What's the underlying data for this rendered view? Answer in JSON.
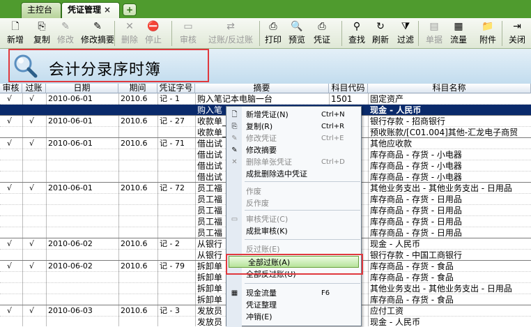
{
  "tabs": [
    {
      "label": "主控台"
    },
    {
      "label": "凭证管理",
      "close": "×"
    }
  ],
  "add_tab": "+",
  "toolbar": [
    {
      "label": "新增",
      "icon": "new-doc-icon",
      "glyph": "🗋",
      "disabled": false
    },
    {
      "label": "复制",
      "icon": "copy-icon",
      "glyph": "⎘",
      "disabled": false
    },
    {
      "label": "修改",
      "icon": "edit-icon",
      "glyph": "✎",
      "disabled": true
    },
    {
      "label": "修改摘要",
      "icon": "edit-summary-icon",
      "glyph": "✎",
      "disabled": false
    },
    {
      "label": "删除",
      "icon": "delete-icon",
      "glyph": "✕",
      "disabled": true
    },
    {
      "label": "停止",
      "icon": "stop-icon",
      "glyph": "⛔",
      "disabled": true
    },
    {
      "label": "审核",
      "icon": "audit-icon",
      "glyph": "▭",
      "disabled": true
    },
    {
      "label": "过账/反过账",
      "icon": "post-icon",
      "glyph": "⇄",
      "disabled": true
    },
    {
      "label": "打印",
      "icon": "print-icon",
      "glyph": "⎙",
      "disabled": false
    },
    {
      "label": "预览",
      "icon": "preview-icon",
      "glyph": "🔍",
      "disabled": false
    },
    {
      "label": "凭证",
      "icon": "voucher-icon",
      "glyph": "⎙",
      "disabled": false
    },
    {
      "label": "查找",
      "icon": "find-icon",
      "glyph": "⚲",
      "disabled": false
    },
    {
      "label": "刷新",
      "icon": "refresh-icon",
      "glyph": "↻",
      "disabled": false
    },
    {
      "label": "过滤",
      "icon": "filter-icon",
      "glyph": "⧩",
      "disabled": false
    },
    {
      "label": "单据",
      "icon": "document-icon",
      "glyph": "▤",
      "disabled": true
    },
    {
      "label": "流量",
      "icon": "flow-icon",
      "glyph": "▦",
      "disabled": false
    },
    {
      "label": "附件",
      "icon": "attachment-icon",
      "glyph": "📁",
      "disabled": false
    },
    {
      "label": "关闭",
      "icon": "close-icon",
      "glyph": "⇥",
      "disabled": false
    }
  ],
  "page_title": "会计分录序时簿",
  "columns": [
    "审核",
    "过账",
    "日期",
    "期间",
    "凭证字号",
    "摘要",
    "科目代码",
    "科目名称"
  ],
  "rows": [
    {
      "audit": "√",
      "post": "√",
      "date": "2010-06-01",
      "period": "2010.6",
      "voucher": "记 - 1",
      "summary": "购入笔记本电脑一台",
      "code": "1501",
      "name": "固定资产",
      "sel": false
    },
    {
      "audit": "",
      "post": "",
      "date": "",
      "period": "",
      "voucher": "",
      "summary": "购入笔",
      "code": "",
      "name": "现金 - 人民币",
      "sel": true
    },
    {
      "audit": "√",
      "post": "√",
      "date": "2010-06-01",
      "period": "2010.6",
      "voucher": "记 - 27",
      "summary": "收款单_",
      "code": "",
      "name": "银行存款 - 招商银行",
      "sel": false
    },
    {
      "audit": "",
      "post": "",
      "date": "",
      "period": "",
      "voucher": "",
      "summary": "收款单_",
      "code": "",
      "name": "预收账款/[C01.004]其他-汇龙电子商贸",
      "sel": false
    },
    {
      "audit": "√",
      "post": "√",
      "date": "2010-06-01",
      "period": "2010.6",
      "voucher": "记 - 71",
      "summary": "借出试",
      "code": "",
      "name": "其他应收款",
      "sel": false
    },
    {
      "audit": "",
      "post": "",
      "date": "",
      "period": "",
      "voucher": "",
      "summary": "借出试",
      "code": "",
      "name": "库存商品 - 存货 - 小电器",
      "sel": false
    },
    {
      "audit": "",
      "post": "",
      "date": "",
      "period": "",
      "voucher": "",
      "summary": "借出试",
      "code": "",
      "name": "库存商品 - 存货 - 小电器",
      "sel": false
    },
    {
      "audit": "",
      "post": "",
      "date": "",
      "period": "",
      "voucher": "",
      "summary": "借出试",
      "code": "",
      "name": "库存商品 - 存货 - 小电器",
      "sel": false
    },
    {
      "audit": "√",
      "post": "√",
      "date": "2010-06-01",
      "period": "2010.6",
      "voucher": "记 - 72",
      "summary": "员工福",
      "code": "",
      "name": "其他业务支出 - 其他业务支出 - 日用品",
      "sel": false
    },
    {
      "audit": "",
      "post": "",
      "date": "",
      "period": "",
      "voucher": "",
      "summary": "员工福",
      "code": "",
      "name": "库存商品 - 存货 - 日用品",
      "sel": false
    },
    {
      "audit": "",
      "post": "",
      "date": "",
      "period": "",
      "voucher": "",
      "summary": "员工福",
      "code": "",
      "name": "库存商品 - 存货 - 日用品",
      "sel": false
    },
    {
      "audit": "",
      "post": "",
      "date": "",
      "period": "",
      "voucher": "",
      "summary": "员工福",
      "code": "",
      "name": "库存商品 - 存货 - 日用品",
      "sel": false
    },
    {
      "audit": "",
      "post": "",
      "date": "",
      "period": "",
      "voucher": "",
      "summary": "员工福",
      "code": "",
      "name": "库存商品 - 存货 - 日用品",
      "sel": false
    },
    {
      "audit": "√",
      "post": "√",
      "date": "2010-06-02",
      "period": "2010.6",
      "voucher": "记 - 2",
      "summary": "从银行",
      "code": "",
      "name": "现金 - 人民币",
      "sel": false
    },
    {
      "audit": "",
      "post": "",
      "date": "",
      "period": "",
      "voucher": "",
      "summary": "从银行",
      "code": "",
      "name": "银行存款 - 中国工商银行",
      "sel": false
    },
    {
      "audit": "√",
      "post": "√",
      "date": "2010-06-02",
      "period": "2010.6",
      "voucher": "记 - 79",
      "summary": "拆卸单",
      "code": "",
      "name": "库存商品 - 存货 - 食品",
      "sel": false
    },
    {
      "audit": "",
      "post": "",
      "date": "",
      "period": "",
      "voucher": "",
      "summary": "拆卸单",
      "code": "",
      "name": "库存商品 - 存货 - 食品",
      "sel": false
    },
    {
      "audit": "",
      "post": "",
      "date": "",
      "period": "",
      "voucher": "",
      "summary": "拆卸单",
      "code": "",
      "name": "其他业务支出 - 其他业务支出 - 日用品",
      "sel": false
    },
    {
      "audit": "",
      "post": "",
      "date": "",
      "period": "",
      "voucher": "",
      "summary": "拆卸单",
      "code": "",
      "name": "库存商品 - 存货 - 食品",
      "sel": false
    },
    {
      "audit": "√",
      "post": "√",
      "date": "2010-06-03",
      "period": "2010.6",
      "voucher": "记 - 3",
      "summary": "发放员",
      "code": "",
      "name": "应付工资",
      "sel": false
    },
    {
      "audit": "",
      "post": "",
      "date": "",
      "period": "",
      "voucher": "",
      "summary": "发放员",
      "code": "",
      "name": "现金 - 人民币",
      "sel": false
    }
  ],
  "context_menu": [
    {
      "label": "新增凭证(N)",
      "key": "Ctrl+N",
      "icon": "new-voucher-icon",
      "glyph": "🗋",
      "disabled": false
    },
    {
      "label": "复制(R)",
      "key": "Ctrl+R",
      "icon": "copy-icon",
      "glyph": "⎘",
      "disabled": false
    },
    {
      "label": "修改凭证",
      "key": "Ctrl+E",
      "icon": "edit-voucher-icon",
      "glyph": "✎",
      "disabled": true
    },
    {
      "label": "修改摘要",
      "key": "",
      "icon": "edit-summary-icon",
      "glyph": "✎",
      "disabled": false
    },
    {
      "label": "删除单张凭证",
      "key": "Ctrl+D",
      "icon": "delete-icon",
      "glyph": "✕",
      "disabled": true
    },
    {
      "label": "成批删除选中凭证",
      "key": "",
      "icon": "",
      "glyph": "",
      "disabled": false
    },
    {
      "label": "作废",
      "key": "",
      "icon": "",
      "glyph": "",
      "disabled": true
    },
    {
      "label": "反作废",
      "key": "",
      "icon": "",
      "glyph": "",
      "disabled": true
    },
    {
      "label": "审核凭证(C)",
      "key": "",
      "icon": "audit-icon",
      "glyph": "▭",
      "disabled": true
    },
    {
      "label": "成批审核(K)",
      "key": "",
      "icon": "",
      "glyph": "",
      "disabled": false
    },
    {
      "label": "反过账(E)",
      "key": "",
      "icon": "",
      "glyph": "",
      "disabled": true
    },
    {
      "label": "全部过账(A)",
      "key": "",
      "icon": "",
      "glyph": "",
      "disabled": false,
      "highlight": true
    },
    {
      "label": "全部反过账(U)",
      "key": "",
      "icon": "",
      "glyph": "",
      "disabled": false
    },
    {
      "label": "现金流量",
      "key": "F6",
      "icon": "cash-flow-icon",
      "glyph": "▦",
      "disabled": false
    },
    {
      "label": "凭证整理",
      "key": "",
      "icon": "",
      "glyph": "",
      "disabled": false
    },
    {
      "label": "冲销(E)",
      "key": "",
      "icon": "",
      "glyph": "",
      "disabled": false
    }
  ]
}
